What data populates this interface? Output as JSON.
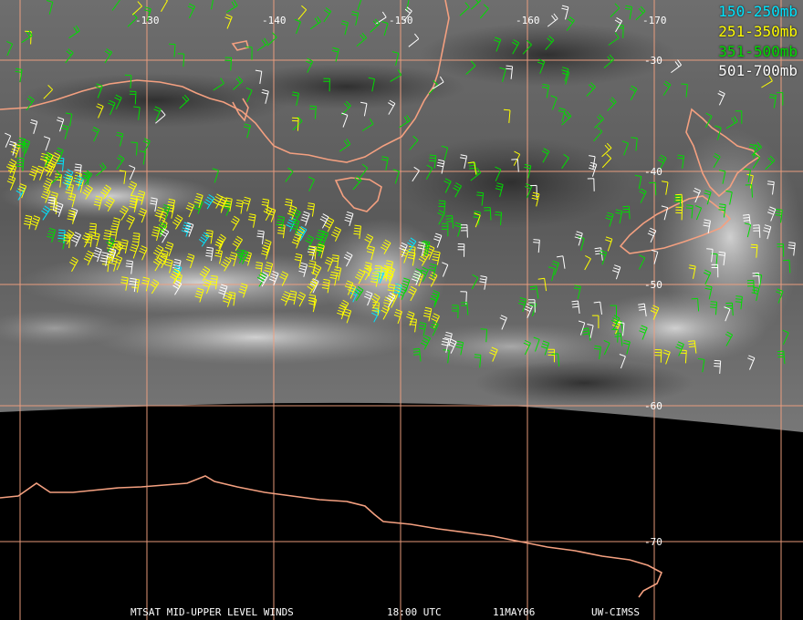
{
  "longitude_labels": [
    "-130",
    "-140",
    "-150",
    "-160",
    "-170"
  ],
  "latitude_labels": [
    "-30",
    "-40",
    "-50",
    "-60",
    "-70"
  ],
  "legend": [
    {
      "label": "150-250mb",
      "color": "#00e5ff"
    },
    {
      "label": "251-350mb",
      "color": "#ffff00"
    },
    {
      "label": "351-500mb",
      "color": "#00dd00"
    },
    {
      "label": "501-700mb",
      "color": "#ffffff"
    }
  ],
  "footer": {
    "title": "MTSAT MID-UPPER LEVEL WINDS",
    "time": "18:00 UTC",
    "date": "11MAY06",
    "credit": "UW-CIMSS"
  },
  "colors": {
    "grid": "#f0a080",
    "coast": "#f4a080",
    "background_space": "#000000",
    "cloud_base": "#6a6a6a"
  },
  "icons": [
    "wind-barb-icon"
  ]
}
